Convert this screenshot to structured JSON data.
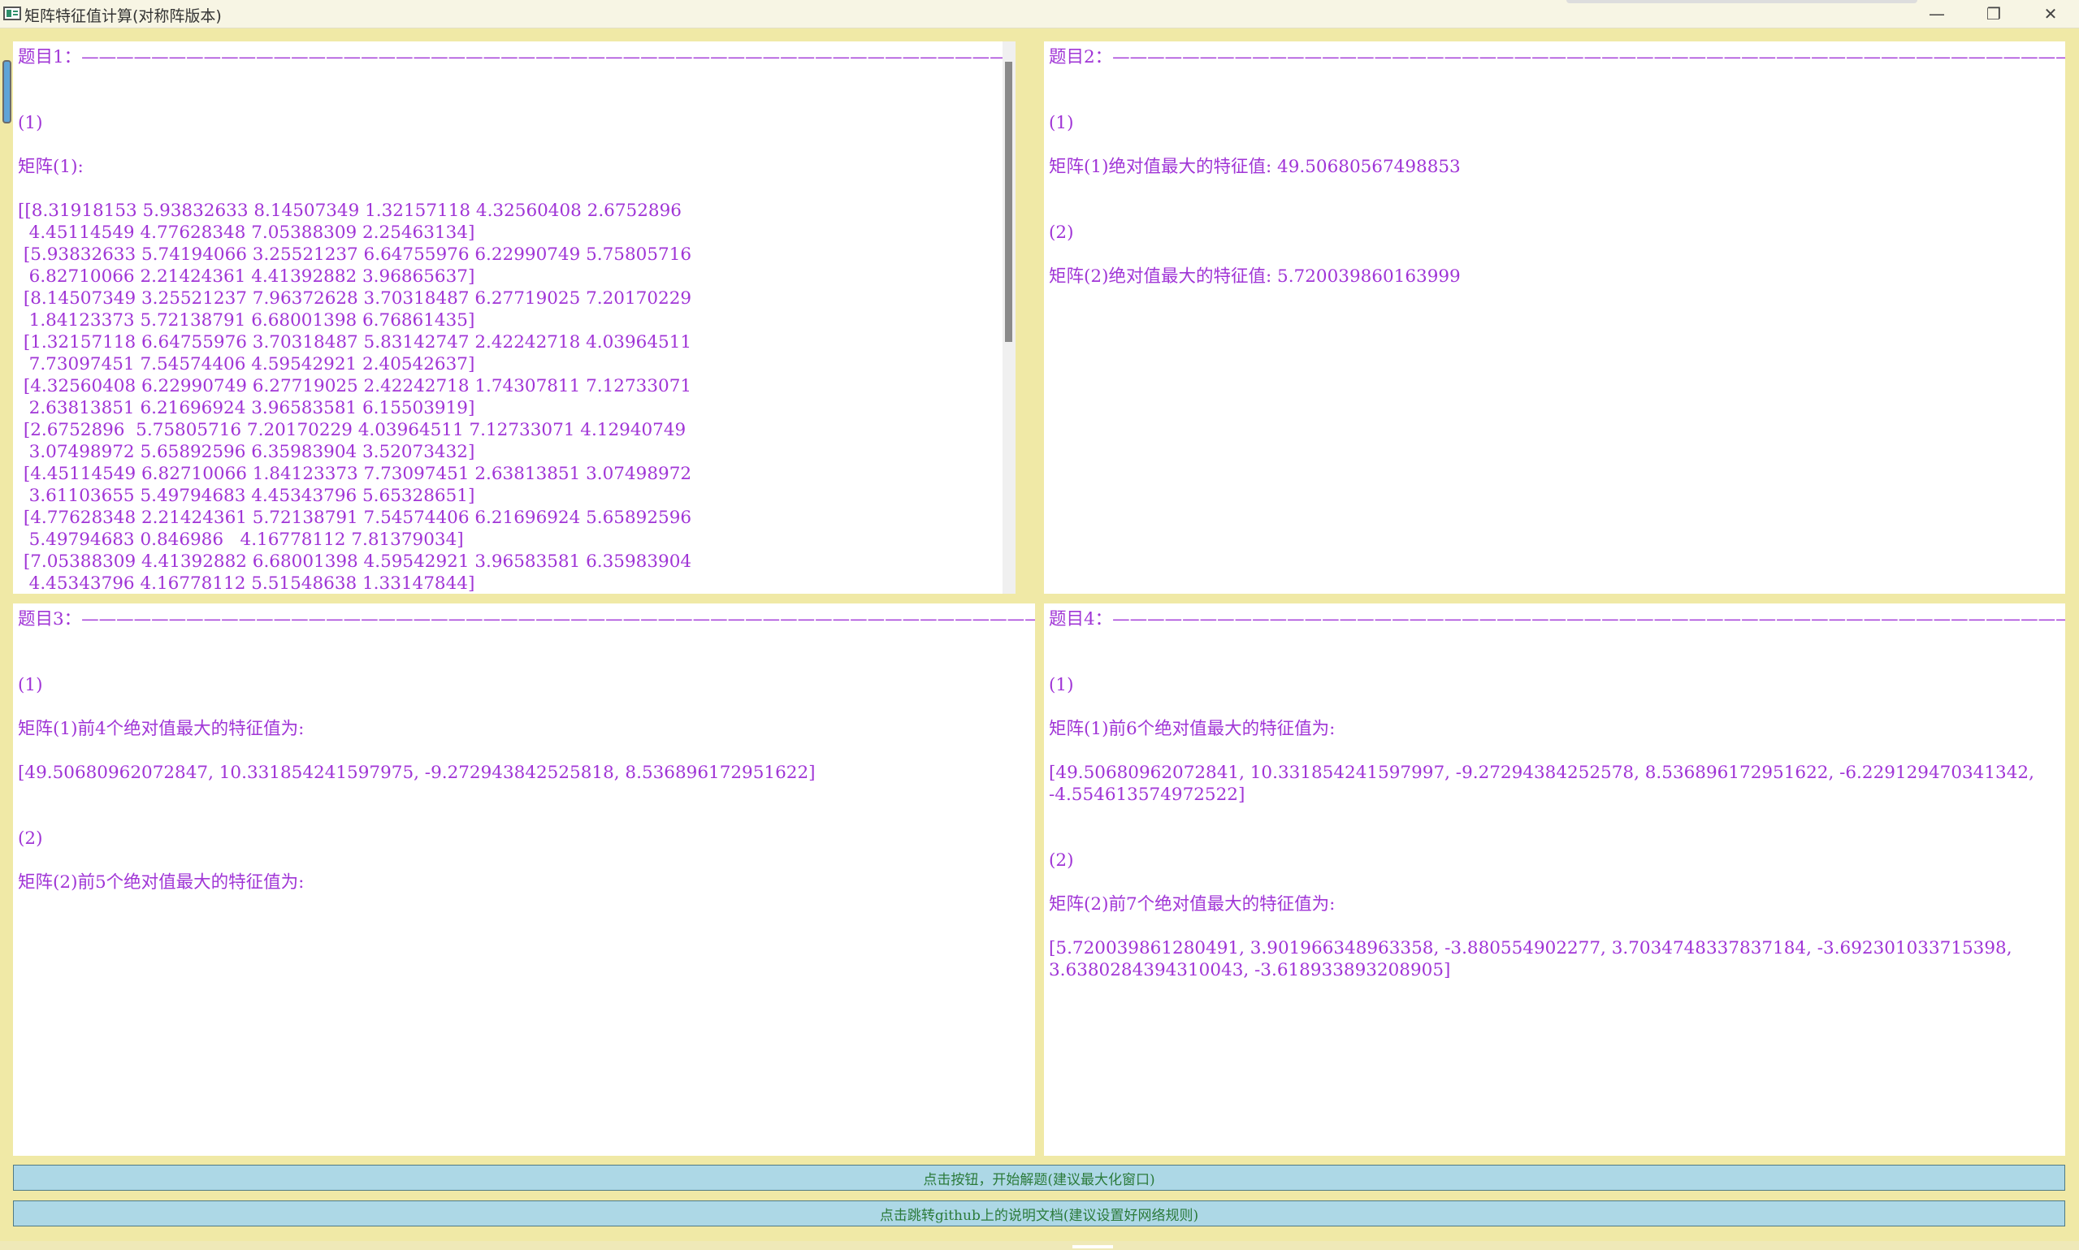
{
  "window": {
    "title": "矩阵特征值计算(对称阵版本)",
    "minimize": "—",
    "maximize": "❐",
    "close": "✕"
  },
  "panels": {
    "p1": "题目1：————————————————————————————————————————————————————————————\n\n\n(1)\n\n矩阵(1):\n\n[[8.31918153 5.93832633 8.14507349 1.32157118 4.32560408 2.6752896\n  4.45114549 4.77628348 7.05388309 2.25463134]\n [5.93832633 5.74194066 3.25521237 6.64755976 6.22990749 5.75805716\n  6.82710066 2.21424361 4.41392882 3.96865637]\n [8.14507349 3.25521237 7.96372628 3.70318487 6.27719025 7.20170229\n  1.84123373 5.72138791 6.68001398 6.76861435]\n [1.32157118 6.64755976 3.70318487 5.83142747 2.42242718 4.03964511\n  7.73097451 7.54574406 4.59542921 2.40542637]\n [4.32560408 6.22990749 6.27719025 2.42242718 1.74307811 7.12733071\n  2.63813851 6.21696924 3.96583581 6.15503919]\n [2.6752896  5.75805716 7.20170229 4.03964511 7.12733071 4.12940749\n  3.07498972 5.65892596 6.35983904 3.52073432]\n [4.45114549 6.82710066 1.84123373 7.73097451 2.63813851 3.07498972\n  3.61103655 5.49794683 4.45343796 5.65328651]\n [4.77628348 2.21424361 5.72138791 7.54574406 6.21696924 5.65892596\n  5.49794683 0.846986   4.16778112 7.81379034]\n [7.05388309 4.41392882 6.68001398 4.59542921 3.96583581 6.35983904\n  4.45343796 4.16778112 5.51548638 1.33147844]",
    "p2": "题目2：————————————————————————————————————————————————————————————\n\n\n(1)\n\n矩阵(1)绝对值最大的特征值: 49.50680567498853\n\n\n(2)\n\n矩阵(2)绝对值最大的特征值: 5.720039860163999",
    "p3": "题目3：————————————————————————————————————————————————————————————\n\n\n(1)\n\n矩阵(1)前4个绝对值最大的特征值为:\n\n[49.50680962072847, 10.331854241597975, -9.272943842525818, 8.536896172951622]\n\n\n(2)\n\n矩阵(2)前5个绝对值最大的特征值为:",
    "p4": "题目4：————————————————————————————————————————————————————————————\n\n\n(1)\n\n矩阵(1)前6个绝对值最大的特征值为:\n\n[49.50680962072841, 10.331854241597997, -9.27294384252578, 8.536896172951622, -6.229129470341342,\n-4.554613574972522]\n\n\n(2)\n\n矩阵(2)前7个绝对值最大的特征值为:\n\n[5.720039861280491, 3.901966348963358, -3.880554902277, 3.7034748337837184, -3.692301033715398,\n3.6380284394310043, -3.618933893208905]"
  },
  "buttons": {
    "solve": "点击按钮，开始解题(建议最大化窗口)",
    "docs": "点击跳转github上的说明文档(建议设置好网络规则)"
  }
}
